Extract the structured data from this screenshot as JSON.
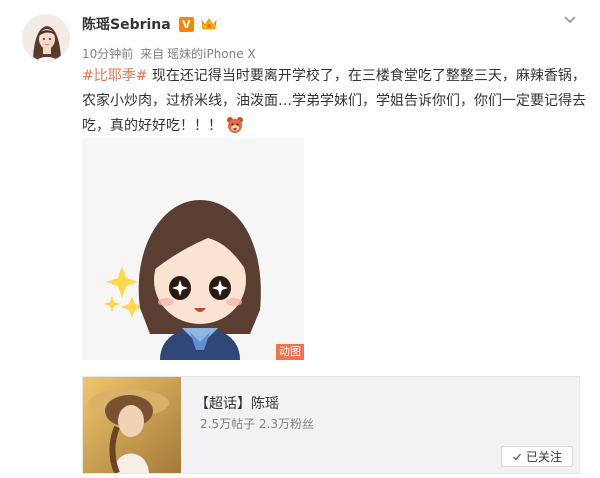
{
  "user": {
    "name": "陈瑶Sebrina",
    "verified_badge": "V",
    "avatar_icon": "avatar-portrait",
    "member_icon": "member-crown-icon"
  },
  "post": {
    "meta": {
      "time": "10分钟前",
      "source_prefix": "来自",
      "device": "瑶妹的iPhone X"
    },
    "hashtag": "#比耶季#",
    "text": " 现在还记得当时要离开学校了，在三楼食堂吃了整整三天，麻辣香锅，农家小炒肉，过桥米线，油泼面…学弟学妹们，学姐告诉你们，你们一定要记得去吃，真的好好吃！！！",
    "emoji_icon": "bear-face-emoji-icon",
    "media": {
      "badge": "动图",
      "image_icon": "cartoon-girl-sticker"
    }
  },
  "card": {
    "title": "【超话】陈瑶",
    "stats": "2.5万帖子 2.3万粉丝",
    "follow_label": "已关注"
  },
  "colors": {
    "accent": "#eb7350",
    "verified": "#ff8200",
    "meta_text": "#808080",
    "card_bg": "#f2f2f5"
  }
}
